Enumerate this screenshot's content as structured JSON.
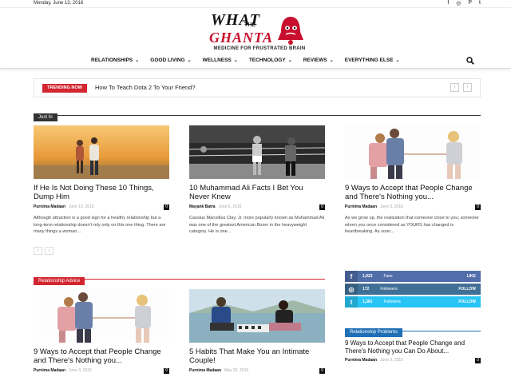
{
  "topbar": {
    "date": "Monday, June 13, 2016",
    "social_icons": [
      "facebook-icon",
      "instagram-icon",
      "pinterest-icon",
      "twitter-icon"
    ],
    "social_glyphs": [
      "f",
      "◎",
      "P",
      "t"
    ]
  },
  "logo": {
    "line1": "WHAT",
    "line2": "THE",
    "line3": "GHANTA",
    "tagline": "MEDICINE FOR FRUSTRATED BRAIN"
  },
  "nav": {
    "items": [
      {
        "label": "RELATIONSHIPS"
      },
      {
        "label": "GOOD LIVING"
      },
      {
        "label": "WELLNESS"
      },
      {
        "label": "TECHNOLOGY"
      },
      {
        "label": "REVIEWS"
      },
      {
        "label": "EVERYTHING ELSE"
      }
    ],
    "chevron": "⌄"
  },
  "trending": {
    "badge": "TRENDING NOW",
    "title": "How To Teach Dota 2 To Your Friend?",
    "prev": "‹",
    "next": "›"
  },
  "just_in": {
    "label": "Just In",
    "cards": [
      {
        "title": "If He Is Not Doing These 10 Things, Dump Him",
        "author": "Purnima Madaan",
        "date": "June 10, 2016",
        "comments": "0",
        "excerpt": "Although attraction is a good sign for a healthy relationship but a long-term relationship doesn't rely only on this one thing. There are many things a woman..."
      },
      {
        "title": "10 Muhammad Ali Facts I Bet You Never Knew",
        "author": "Mayank Batra",
        "date": "June 6, 2016",
        "comments": "0",
        "excerpt": "Cassius Marcellus Clay, Jr. more popularly known as Muhammad Ali was one of the greatest American Boxer in the heavyweight category. He is one..."
      },
      {
        "title": "9 Ways to Accept that People Change and There's Nothing you...",
        "author": "Purnima Madaan",
        "date": "June 3, 2016",
        "comments": "0",
        "excerpt": "As we grow up, the realization that someone close to you; someone whom you once considered as YOURS has changed is heartbreaking. As soon..."
      }
    ],
    "pager": [
      "‹",
      "›"
    ]
  },
  "relationship_advice": {
    "label": "Relationship Advice",
    "cards": [
      {
        "title": "9 Ways to Accept that People Change and There's Nothing you...",
        "author": "Purnima Madaan",
        "date": "June 3, 2016",
        "comments": "0"
      },
      {
        "title": "5 Habits That Make You an Intimate Couple!",
        "author": "Purnima Madaan",
        "date": "May 26, 2016",
        "comments": "0"
      }
    ]
  },
  "sidebar": {
    "social": [
      {
        "glyph": "f",
        "icon": "facebook-icon",
        "count": "1,923",
        "label": "Fans",
        "action": "LIKE",
        "color": "#516eab"
      },
      {
        "glyph": "◎",
        "icon": "instagram-icon",
        "count": "172",
        "label": "Followers",
        "action": "FOLLOW",
        "color": "#417096"
      },
      {
        "glyph": "t",
        "icon": "twitter-icon",
        "count": "1,381",
        "label": "Followers",
        "action": "FOLLOW",
        "color": "#29c5f6"
      }
    ]
  },
  "relationship_problems": {
    "label": "Relationship Problems",
    "card": {
      "title": "9 Ways to Accept that People Change and There's Nothing you Can Do About...",
      "author": "Purnima Madaan",
      "date": "June 3, 2016",
      "comments": "0"
    }
  },
  "colors": {
    "accent": "#d22630",
    "dark": "#333333",
    "blue": "#1f6fb5"
  }
}
